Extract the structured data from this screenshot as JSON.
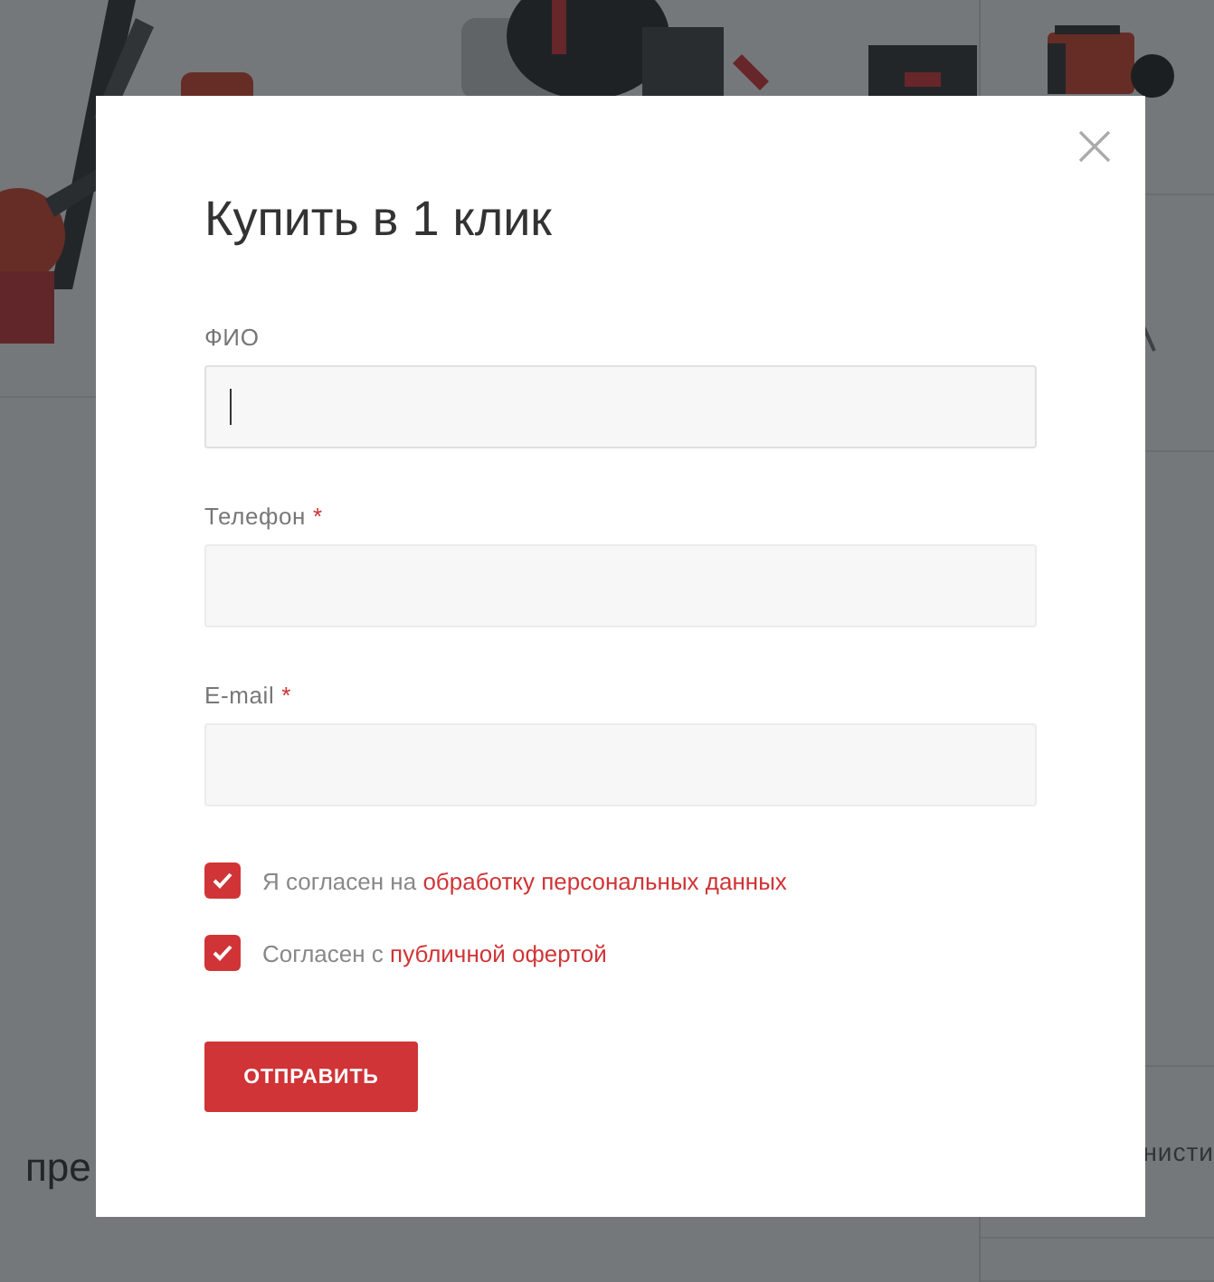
{
  "background": {
    "fragments": [
      {
        "text": "нисти",
        "kind": "side"
      },
      {
        "text": "пре",
        "kind": "heading"
      }
    ]
  },
  "modal": {
    "title": "Купить в 1 клик",
    "fields": [
      {
        "label": "ФИО",
        "focused": true
      },
      {
        "label": "Телефон",
        "mark": "*",
        "focused": false
      },
      {
        "label": "E-mail",
        "mark": "*",
        "focused": false
      }
    ],
    "agreements": [
      {
        "text": "Я согласен на ",
        "link": "обработку персональных данных",
        "checked": true
      },
      {
        "text": "Согласен с ",
        "link": "публичной офертой",
        "checked": true
      }
    ],
    "submit": "ОТПРАВИТЬ"
  }
}
